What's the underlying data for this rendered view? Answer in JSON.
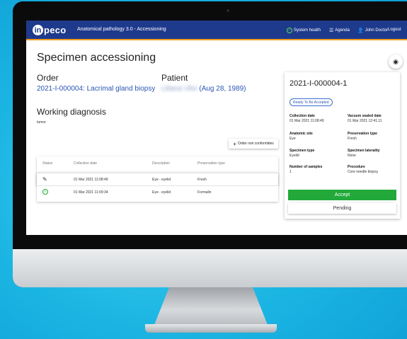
{
  "header": {
    "logo_mark": "in",
    "logo_text": "peco",
    "app_title": "Anatomical pathology 3.0 - Accessioning",
    "system_health": "System health",
    "agenda": "Agenda",
    "user": "John Doctor",
    "logout": "Logout"
  },
  "page": {
    "title": "Specimen accessioning"
  },
  "order": {
    "label": "Order",
    "value": "2021-I-000004: Lacrimal gland biopsy"
  },
  "patient": {
    "label": "Patient",
    "name": "Liliana Ulivi",
    "dob": "(Aug 28, 1989)"
  },
  "diagnosis": {
    "label": "Working diagnosis",
    "value": "tumor"
  },
  "actions": {
    "order_non_conformities": "Order non conformities"
  },
  "table": {
    "headers": [
      "Status",
      "Collection date",
      "Description",
      "Preservation type"
    ],
    "rows": [
      {
        "status": "edit",
        "date": "01 Mar 2021 11:08:49",
        "description": "Eye - eyelid",
        "preservation": "Fresh"
      },
      {
        "status": "ok",
        "date": "01 Mar 2021 11:09:34",
        "description": "Eye - eyelid",
        "preservation": "Formalin"
      }
    ]
  },
  "panel": {
    "title": "2021-I-000004-1",
    "badge": "Ready To Be Accepted",
    "fields": [
      {
        "label": "Collection date",
        "value": "01 Mar 2021 11:08:49"
      },
      {
        "label": "Vacuum sealed date",
        "value": "01 Mar 2021 12:41:11"
      },
      {
        "label": "Anatomic site",
        "value": "Eye"
      },
      {
        "label": "Preservation type",
        "value": "Fresh"
      },
      {
        "label": "Specimen type",
        "value": "Eyelid"
      },
      {
        "label": "Specimen laterality",
        "value": "None"
      },
      {
        "label": "Number of samples",
        "value": "1"
      },
      {
        "label": "Procedure",
        "value": "Core needle biopsy"
      }
    ],
    "accept": "Accept",
    "pending": "Pending"
  },
  "colors": {
    "brand": "#1e3a8c",
    "accent": "#f09a1c",
    "success": "#22a93a",
    "link": "#2b56b5",
    "background": "#1bb8e4"
  }
}
